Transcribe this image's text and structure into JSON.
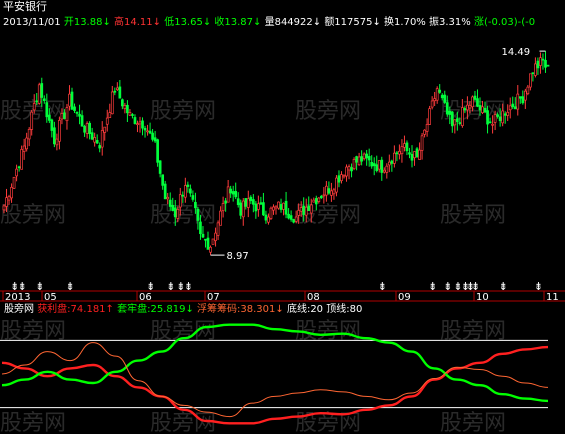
{
  "header": {
    "title": "平安银行",
    "date": "2013/11/01",
    "items": [
      {
        "label": "开",
        "value": "13.88",
        "arrow": "↓",
        "color": "#00ff00"
      },
      {
        "label": "高",
        "value": "14.11",
        "arrow": "↓",
        "color": "#ff3333"
      },
      {
        "label": "低",
        "value": "13.65",
        "arrow": "↓",
        "color": "#00ff00"
      },
      {
        "label": "收",
        "value": "13.87",
        "arrow": "↓",
        "color": "#00ff00"
      },
      {
        "label": "量",
        "value": "844922",
        "arrow": "↓",
        "color": "#ffffff"
      },
      {
        "label": "额",
        "value": "117575",
        "arrow": "↓",
        "color": "#ffffff"
      },
      {
        "label": "换",
        "value": "1.70%",
        "arrow": "",
        "color": "#ffffff"
      },
      {
        "label": "振",
        "value": "3.31%",
        "arrow": "",
        "color": "#ffffff"
      },
      {
        "label": "涨",
        "value": "(-0.03)-(-0",
        "arrow": "",
        "color": "#00ff00"
      }
    ]
  },
  "markers": {
    "high_label": "14.49",
    "low_label": "8.97"
  },
  "months": [
    "2013",
    "05",
    "06",
    "07",
    "08",
    "09",
    "10",
    "11"
  ],
  "indicator": {
    "name": "股旁网",
    "items": [
      {
        "label": "获利盘",
        "value": "74.181",
        "arrow": "↑",
        "color": "#ff2020"
      },
      {
        "label": "套牢盘",
        "value": "25.819",
        "arrow": "↓",
        "color": "#00ff00"
      },
      {
        "label": "浮筹筹码",
        "value": "38.301",
        "arrow": "↓",
        "color": "#ff6633"
      },
      {
        "label": "底线",
        "value": "20",
        "arrow": "",
        "color": "#ffffff"
      },
      {
        "label": "顶线",
        "value": "80",
        "arrow": "",
        "color": "#ffffff"
      }
    ]
  },
  "watermark": "股旁网",
  "colors": {
    "up": "#ff3c3c",
    "down": "#00ff3c",
    "axis": "#b00000",
    "profit": "#ff2020",
    "trapped": "#00ff00",
    "float": "#ff6633"
  },
  "chart_data": [
    {
      "type": "candlestick",
      "title": "平安银行",
      "ylim": [
        8.5,
        14.8
      ],
      "high": 14.49,
      "low": 8.97,
      "anchors": [
        [
          0,
          10.4
        ],
        [
          8,
          11.9
        ],
        [
          14,
          13.5
        ],
        [
          20,
          12.1
        ],
        [
          26,
          13.1
        ],
        [
          32,
          12.4
        ],
        [
          38,
          12.0
        ],
        [
          44,
          13.4
        ],
        [
          50,
          12.7
        ],
        [
          56,
          12.5
        ],
        [
          60,
          11.9
        ],
        [
          64,
          10.6
        ],
        [
          68,
          10.2
        ],
        [
          72,
          11.0
        ],
        [
          76,
          10.2
        ],
        [
          78,
          9.6
        ],
        [
          82,
          9.4
        ],
        [
          86,
          10.2
        ],
        [
          90,
          10.9
        ],
        [
          94,
          10.3
        ],
        [
          98,
          10.5
        ],
        [
          104,
          10.2
        ],
        [
          110,
          10.4
        ],
        [
          116,
          10.1
        ],
        [
          122,
          10.5
        ],
        [
          130,
          10.9
        ],
        [
          136,
          11.4
        ],
        [
          142,
          11.6
        ],
        [
          150,
          11.4
        ],
        [
          158,
          11.9
        ],
        [
          164,
          11.6
        ],
        [
          172,
          13.4
        ],
        [
          178,
          12.4
        ],
        [
          186,
          13.1
        ],
        [
          194,
          12.5
        ],
        [
          200,
          12.9
        ],
        [
          206,
          13.2
        ],
        [
          210,
          13.9
        ],
        [
          214,
          14.1
        ],
        [
          216,
          13.87
        ]
      ]
    },
    {
      "type": "line",
      "ylim": [
        0,
        100
      ],
      "series": [
        {
          "name": "获利盘",
          "values": [
            60,
            55,
            48,
            55,
            58,
            48,
            38,
            30,
            18,
            8,
            6,
            6,
            10,
            12,
            15,
            14,
            18,
            22,
            30,
            45,
            55,
            60,
            68,
            72,
            74
          ]
        },
        {
          "name": "套牢盘",
          "values": [
            40,
            45,
            52,
            45,
            42,
            52,
            62,
            70,
            82,
            92,
            94,
            94,
            90,
            88,
            85,
            86,
            82,
            78,
            70,
            55,
            45,
            40,
            32,
            28,
            26
          ]
        },
        {
          "name": "浮筹筹码",
          "values": [
            50,
            58,
            70,
            62,
            78,
            66,
            44,
            30,
            22,
            16,
            12,
            24,
            30,
            33,
            36,
            34,
            30,
            27,
            33,
            46,
            56,
            54,
            48,
            42,
            38
          ]
        }
      ],
      "hlines": [
        20,
        80
      ]
    }
  ]
}
